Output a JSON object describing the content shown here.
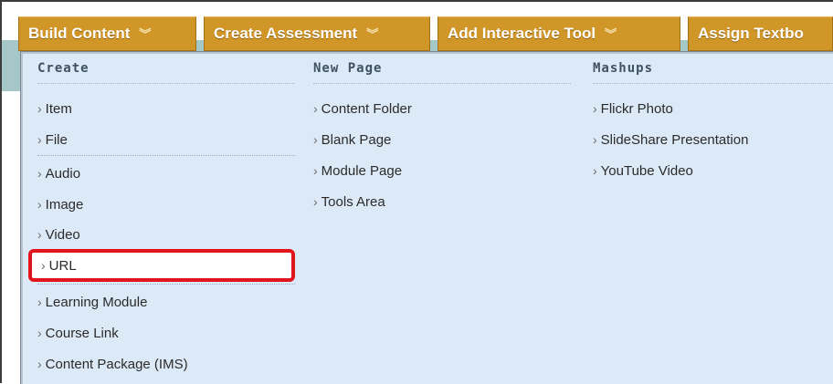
{
  "tabs": [
    {
      "label": "Build Content"
    },
    {
      "label": "Create Assessment"
    },
    {
      "label": "Add Interactive Tool"
    },
    {
      "label": "Assign Textbo"
    }
  ],
  "chevron_glyph": "≫",
  "arrow_glyph": "›",
  "columns": {
    "create": {
      "heading": "Create",
      "items": [
        "Item",
        "File",
        "Audio",
        "Image",
        "Video",
        "URL",
        "Learning Module",
        "Course Link",
        "Content Package (IMS)"
      ]
    },
    "new_page": {
      "heading": "New Page",
      "items": [
        "Content Folder",
        "Blank Page",
        "Module Page",
        "Tools Area"
      ]
    },
    "mashups": {
      "heading": "Mashups",
      "items": [
        "Flickr Photo",
        "SlideShare Presentation",
        "YouTube Video"
      ]
    }
  },
  "highlighted_item": "URL",
  "colors": {
    "tab_bg": "#d09628",
    "menu_bg": "#dce9f6",
    "highlight_border": "#e2141b"
  }
}
